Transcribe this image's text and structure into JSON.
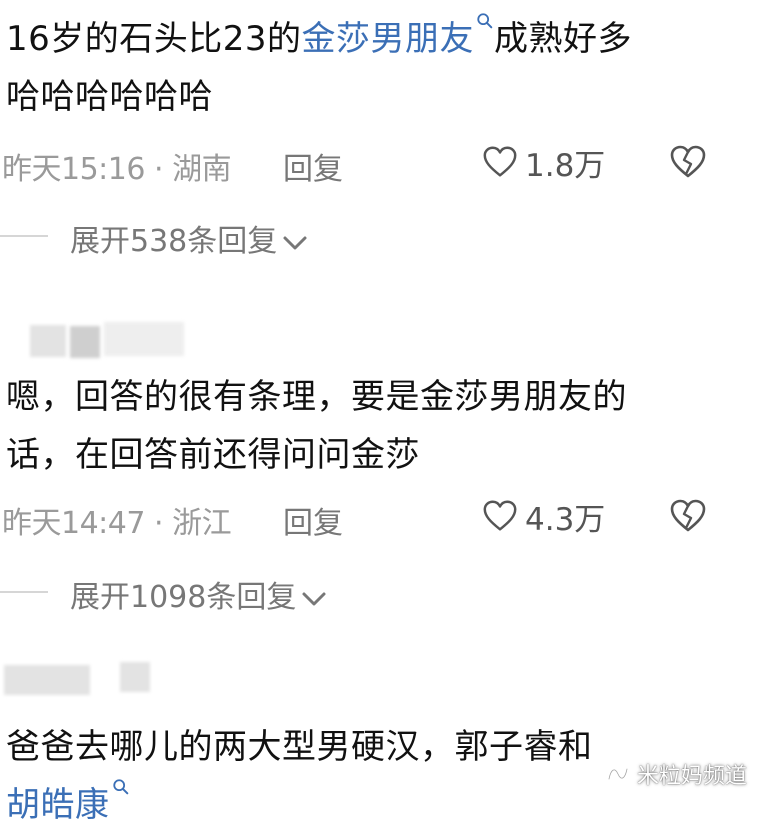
{
  "comments": [
    {
      "text_before": "16岁的石头比23的",
      "link_text": "金莎男朋友",
      "text_after_line1": "成熟好多",
      "text_line2": "哈哈哈哈哈哈",
      "time_location": "昨天15:16 · 湖南",
      "reply_label": "回复",
      "like_count": "1.8万",
      "expand_label": "展开538条回复"
    },
    {
      "text_line1": "嗯，回答的很有条理，要是金莎男朋友的",
      "text_line2": "话，在回答前还得问问金莎",
      "time_location": "昨天14:47 · 浙江",
      "reply_label": "回复",
      "like_count": "4.3万",
      "expand_label": "展开1098条回复"
    },
    {
      "text_line1": "爸爸去哪儿的两大型男硬汉，郭子睿和",
      "link_text": "胡皓康"
    }
  ],
  "watermark": {
    "label": "米粒妈频道"
  },
  "icons": {
    "like": "heart-outline-icon",
    "dislike": "broken-heart-icon",
    "expand": "chevron-down-icon",
    "search": "search-icon",
    "watermark": "wechat-channel-icon"
  },
  "colors": {
    "link": "#3b6fb6",
    "meta": "#9a9a9a",
    "text": "#111111"
  }
}
